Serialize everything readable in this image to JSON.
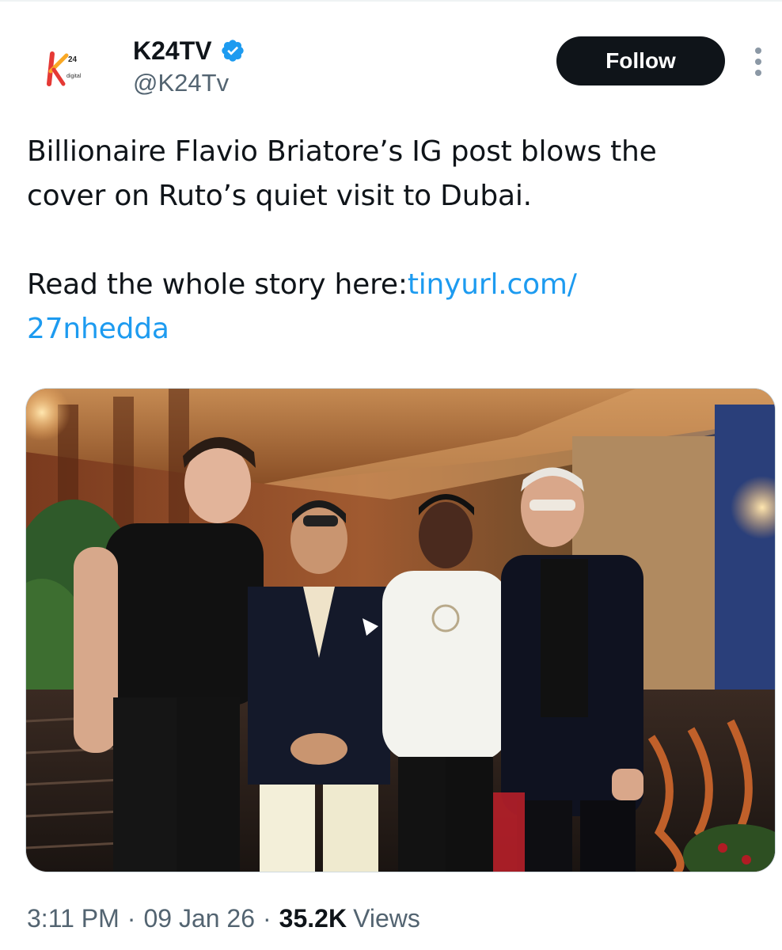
{
  "author": {
    "display_name": "K24TV",
    "handle": "@K24Tv",
    "verified": true,
    "avatar_icon": "k24-digital-logo-icon"
  },
  "actions": {
    "follow_label": "Follow",
    "more_icon": "more-vertical-icon"
  },
  "tweet": {
    "line1": "Billionaire Flavio Briatore’s IG post blows the",
    "line2": "cover on Ruto’s quiet visit to Dubai.",
    "read_prefix": "Read the whole story here:",
    "link_part1": "tinyurl.com/",
    "link_part2": "27nhedda"
  },
  "media": {
    "kind": "photo",
    "subject": "four men posing on a staircase in a restaurant"
  },
  "meta": {
    "time": "3:11 PM",
    "separator": "·",
    "date": "09 Jan 26",
    "views_count": "35.2K",
    "views_label": "Views"
  },
  "colors": {
    "text": "#0f1419",
    "secondary": "#536471",
    "link": "#1d9bf0",
    "verified": "#1d9bf0",
    "follow_bg": "#0f1419"
  }
}
